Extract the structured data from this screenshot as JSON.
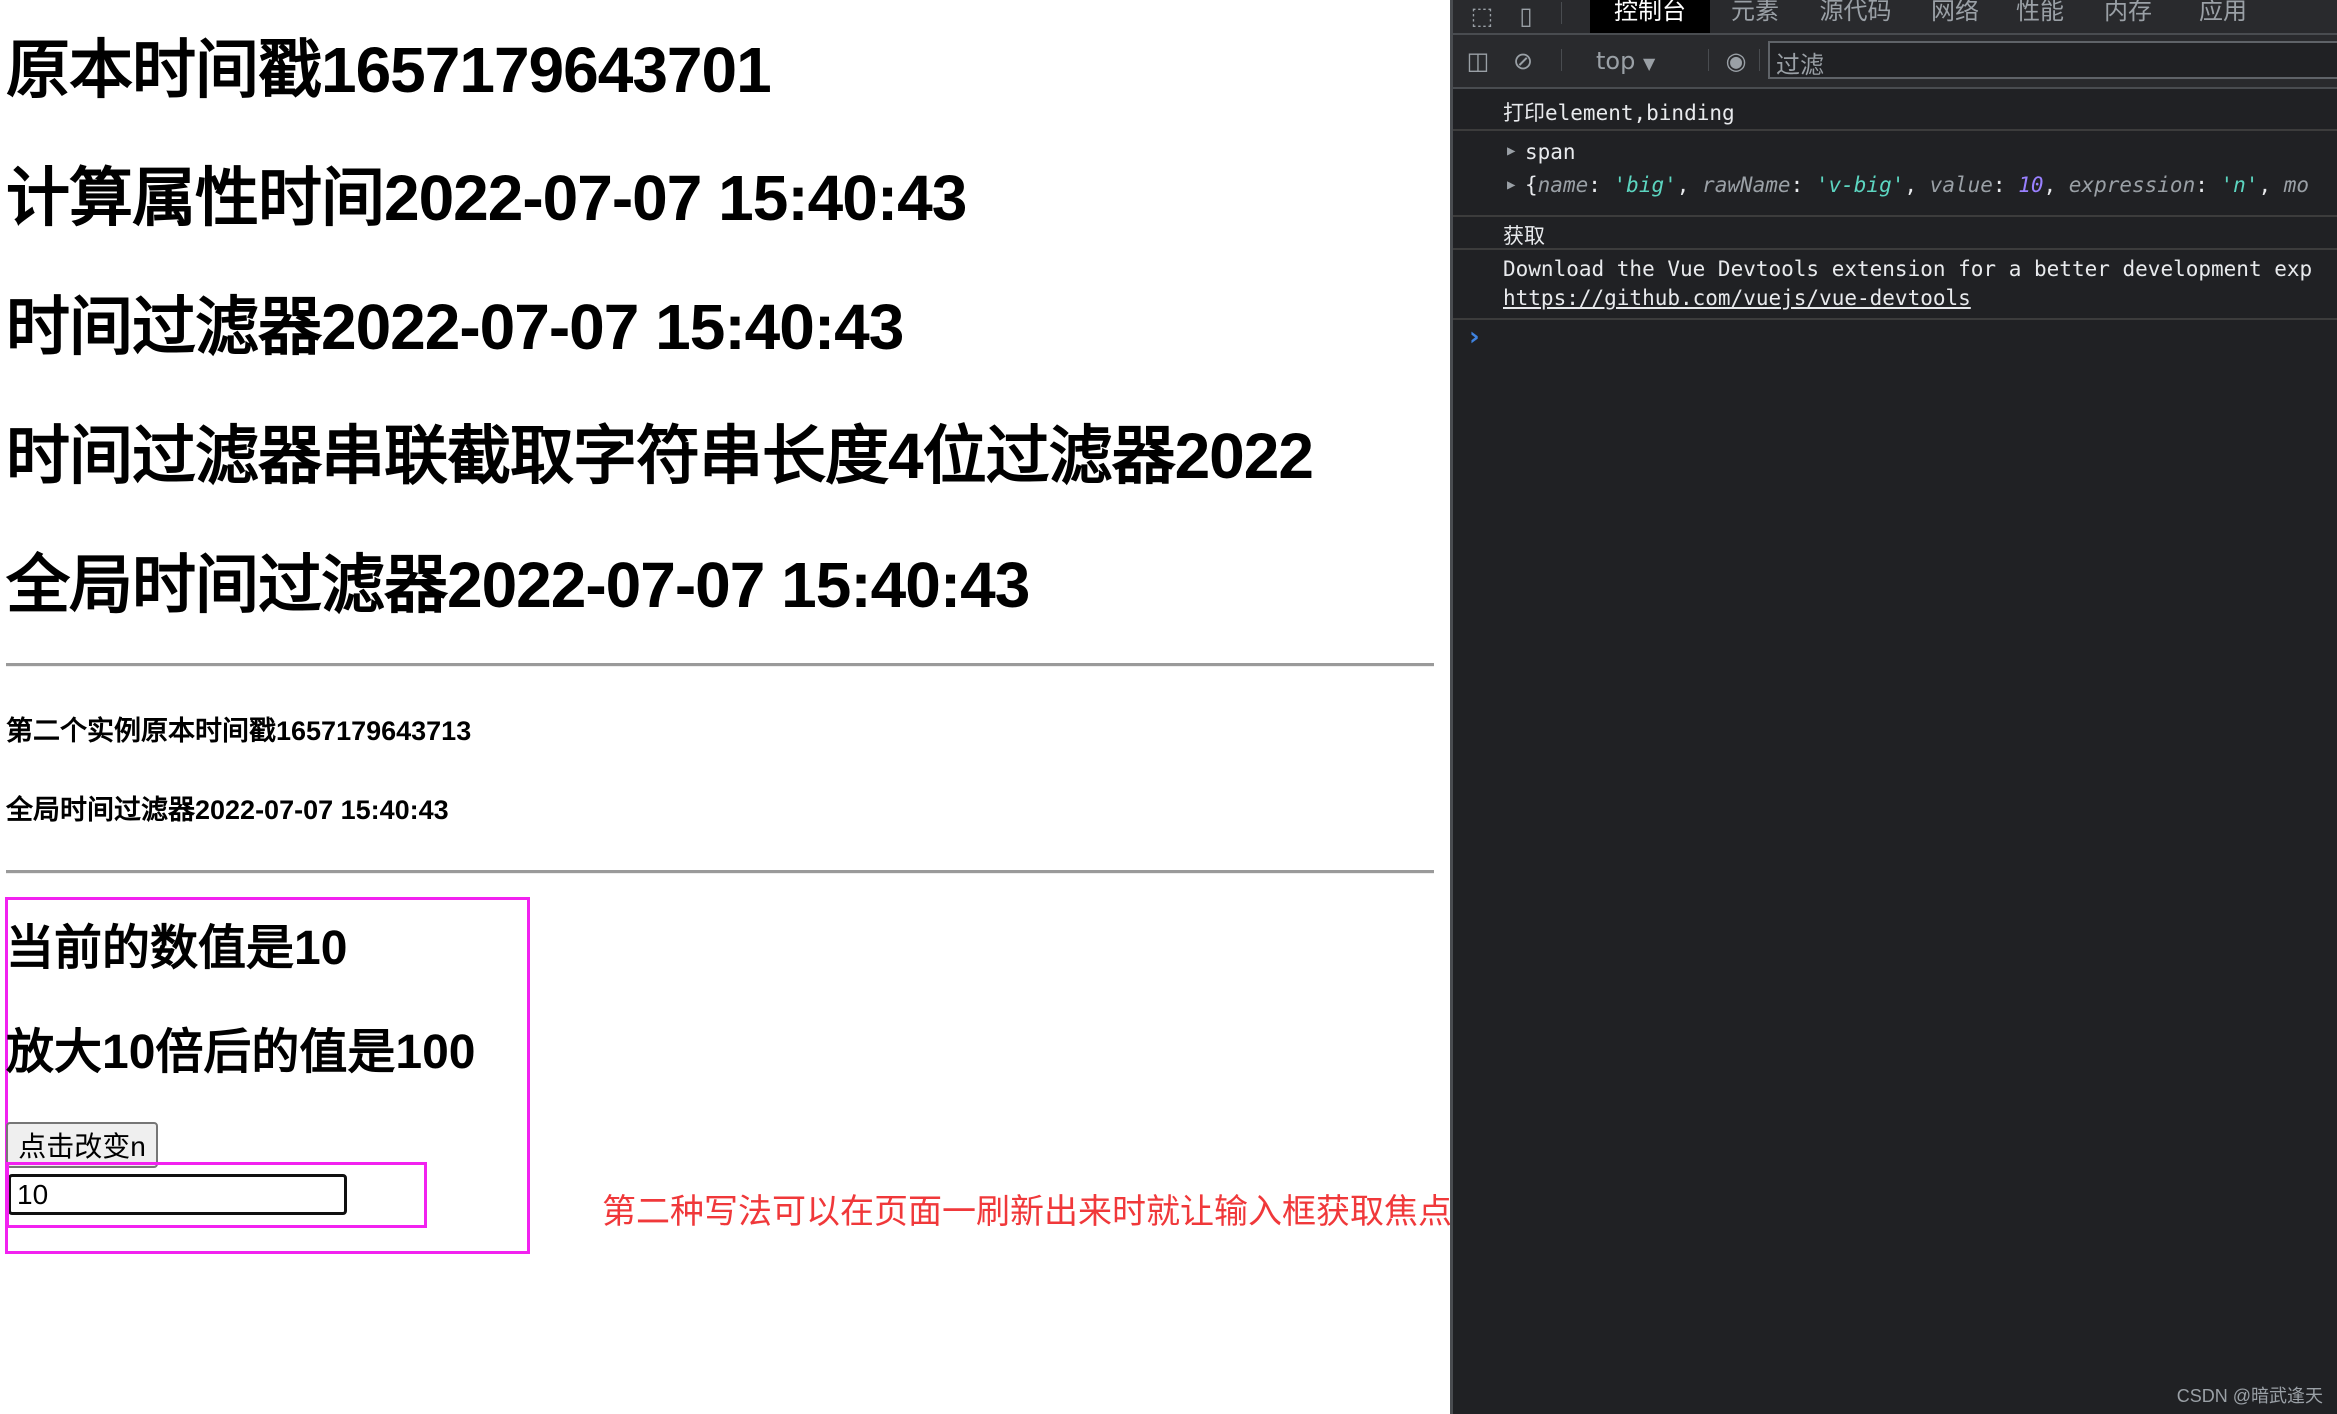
{
  "page": {
    "headings": [
      "原本时间戳1657179643701",
      "计算属性时间2022-07-07 15:40:43",
      "时间过滤器2022-07-07 15:40:43",
      "时间过滤器串联截取字符串长度4位过滤器2022",
      "全局时间过滤器2022-07-07 15:40:43"
    ],
    "second_instance": {
      "timestamp_line": "第二个实例原本时间戳1657179643713",
      "global_filter_line": "全局时间过滤器2022-07-07 15:40:43"
    },
    "directive_demo": {
      "current_value_line": "当前的数值是10",
      "enlarged_value_line": "放大10倍后的值是100",
      "change_button_label": "点击改变n",
      "input_value": "10"
    },
    "annotation": {
      "text": "第二种写法可以在页面一刷新出来时就让输入框获取焦点",
      "color": "#f0383a"
    },
    "highlight_color": "#f222f0"
  },
  "devtools": {
    "tabs": [
      {
        "label": "控制台",
        "active": true
      },
      {
        "label": "元素",
        "active": false
      },
      {
        "label": "源代码",
        "active": false
      },
      {
        "label": "网络",
        "active": false
      },
      {
        "label": "性能",
        "active": false
      },
      {
        "label": "内存",
        "active": false
      },
      {
        "label": "应用",
        "active": false
      }
    ],
    "toolbar": {
      "context": "top",
      "filter_placeholder": "过滤"
    },
    "console": {
      "log1": "打印element,binding",
      "log2_element": "span",
      "log2_object": {
        "open": "{",
        "k1": "name",
        "v1": "'big'",
        "k2": "rawName",
        "v2": "'v-big'",
        "k3": "value",
        "v3": "10",
        "k4": "expression",
        "v4": "'n'",
        "k5": "mo"
      },
      "log3": "获取",
      "log4_text": "Download the Vue Devtools extension for a better development exp",
      "log4_link": "https://github.com/vuejs/vue-devtools"
    }
  },
  "watermark": "CSDN @暗武逢天"
}
